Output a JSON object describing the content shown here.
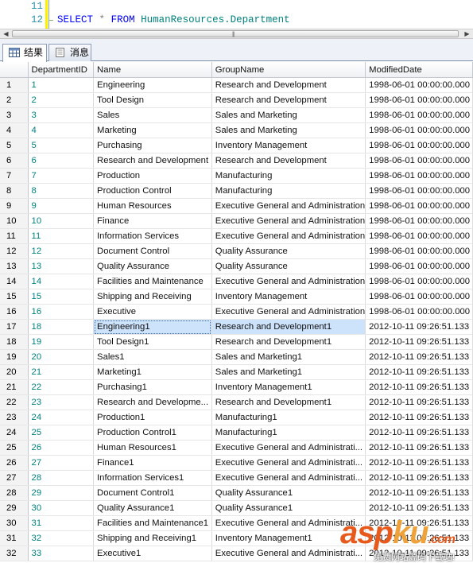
{
  "editor": {
    "lines": [
      {
        "num": "11",
        "code": ""
      },
      {
        "num": "12",
        "code": "SELECT * FROM HumanResources.Department"
      }
    ],
    "code_tokens": {
      "select": "SELECT",
      "star": "*",
      "from": "FROM",
      "table": "HumanResources.Department"
    }
  },
  "tabs": [
    {
      "label": "结果",
      "icon": "grid-icon",
      "active": true
    },
    {
      "label": "消息",
      "icon": "messages-icon",
      "active": false
    }
  ],
  "grid": {
    "columns": [
      "",
      "DepartmentID",
      "Name",
      "GroupName",
      "ModifiedDate"
    ],
    "selected_row": 17,
    "rows": [
      [
        "1",
        "1",
        "Engineering",
        "Research and Development",
        "1998-06-01 00:00:00.000"
      ],
      [
        "2",
        "2",
        "Tool Design",
        "Research and Development",
        "1998-06-01 00:00:00.000"
      ],
      [
        "3",
        "3",
        "Sales",
        "Sales and Marketing",
        "1998-06-01 00:00:00.000"
      ],
      [
        "4",
        "4",
        "Marketing",
        "Sales and Marketing",
        "1998-06-01 00:00:00.000"
      ],
      [
        "5",
        "5",
        "Purchasing",
        "Inventory Management",
        "1998-06-01 00:00:00.000"
      ],
      [
        "6",
        "6",
        "Research and Development",
        "Research and Development",
        "1998-06-01 00:00:00.000"
      ],
      [
        "7",
        "7",
        "Production",
        "Manufacturing",
        "1998-06-01 00:00:00.000"
      ],
      [
        "8",
        "8",
        "Production Control",
        "Manufacturing",
        "1998-06-01 00:00:00.000"
      ],
      [
        "9",
        "9",
        "Human Resources",
        "Executive General and Administration",
        "1998-06-01 00:00:00.000"
      ],
      [
        "10",
        "10",
        "Finance",
        "Executive General and Administration",
        "1998-06-01 00:00:00.000"
      ],
      [
        "11",
        "11",
        "Information Services",
        "Executive General and Administration",
        "1998-06-01 00:00:00.000"
      ],
      [
        "12",
        "12",
        "Document Control",
        "Quality Assurance",
        "1998-06-01 00:00:00.000"
      ],
      [
        "13",
        "13",
        "Quality Assurance",
        "Quality Assurance",
        "1998-06-01 00:00:00.000"
      ],
      [
        "14",
        "14",
        "Facilities and Maintenance",
        "Executive General and Administration",
        "1998-06-01 00:00:00.000"
      ],
      [
        "15",
        "15",
        "Shipping and Receiving",
        "Inventory Management",
        "1998-06-01 00:00:00.000"
      ],
      [
        "16",
        "16",
        "Executive",
        "Executive General and Administration",
        "1998-06-01 00:00:00.000"
      ],
      [
        "17",
        "18",
        "Engineering1",
        "Research and Development1",
        "2012-10-11 09:26:51.133"
      ],
      [
        "18",
        "19",
        "Tool Design1",
        "Research and Development1",
        "2012-10-11 09:26:51.133"
      ],
      [
        "19",
        "20",
        "Sales1",
        "Sales and Marketing1",
        "2012-10-11 09:26:51.133"
      ],
      [
        "20",
        "21",
        "Marketing1",
        "Sales and Marketing1",
        "2012-10-11 09:26:51.133"
      ],
      [
        "21",
        "22",
        "Purchasing1",
        "Inventory Management1",
        "2012-10-11 09:26:51.133"
      ],
      [
        "22",
        "23",
        "Research and Developme...",
        "Research and Development1",
        "2012-10-11 09:26:51.133"
      ],
      [
        "23",
        "24",
        "Production1",
        "Manufacturing1",
        "2012-10-11 09:26:51.133"
      ],
      [
        "24",
        "25",
        "Production Control1",
        "Manufacturing1",
        "2012-10-11 09:26:51.133"
      ],
      [
        "25",
        "26",
        "Human Resources1",
        "Executive General and Administrati...",
        "2012-10-11 09:26:51.133"
      ],
      [
        "26",
        "27",
        "Finance1",
        "Executive General and Administrati...",
        "2012-10-11 09:26:51.133"
      ],
      [
        "27",
        "28",
        "Information Services1",
        "Executive General and Administrati...",
        "2012-10-11 09:26:51.133"
      ],
      [
        "28",
        "29",
        "Document Control1",
        "Quality Assurance1",
        "2012-10-11 09:26:51.133"
      ],
      [
        "29",
        "30",
        "Quality Assurance1",
        "Quality Assurance1",
        "2012-10-11 09:26:51.133"
      ],
      [
        "30",
        "31",
        "Facilities and Maintenance1",
        "Executive General and Administrati...",
        "2012-10-11 09:26:51.133"
      ],
      [
        "31",
        "32",
        "Shipping and Receiving1",
        "Inventory Management1",
        "2012-10-11 09:26:51.133"
      ],
      [
        "32",
        "33",
        "Executive1",
        "Executive General and Administrati...",
        "2012-10-11 09:26:51.133"
      ]
    ]
  },
  "watermark": {
    "logo_a": "asp",
    "logo_b": "ku",
    "logo_c": ".com",
    "subtitle": "免费网站源码下载站!"
  },
  "colors": {
    "keyword": "#0000ff",
    "identifier": "#008080",
    "selection": "#cde3fb",
    "watermark": "#e8591c"
  }
}
